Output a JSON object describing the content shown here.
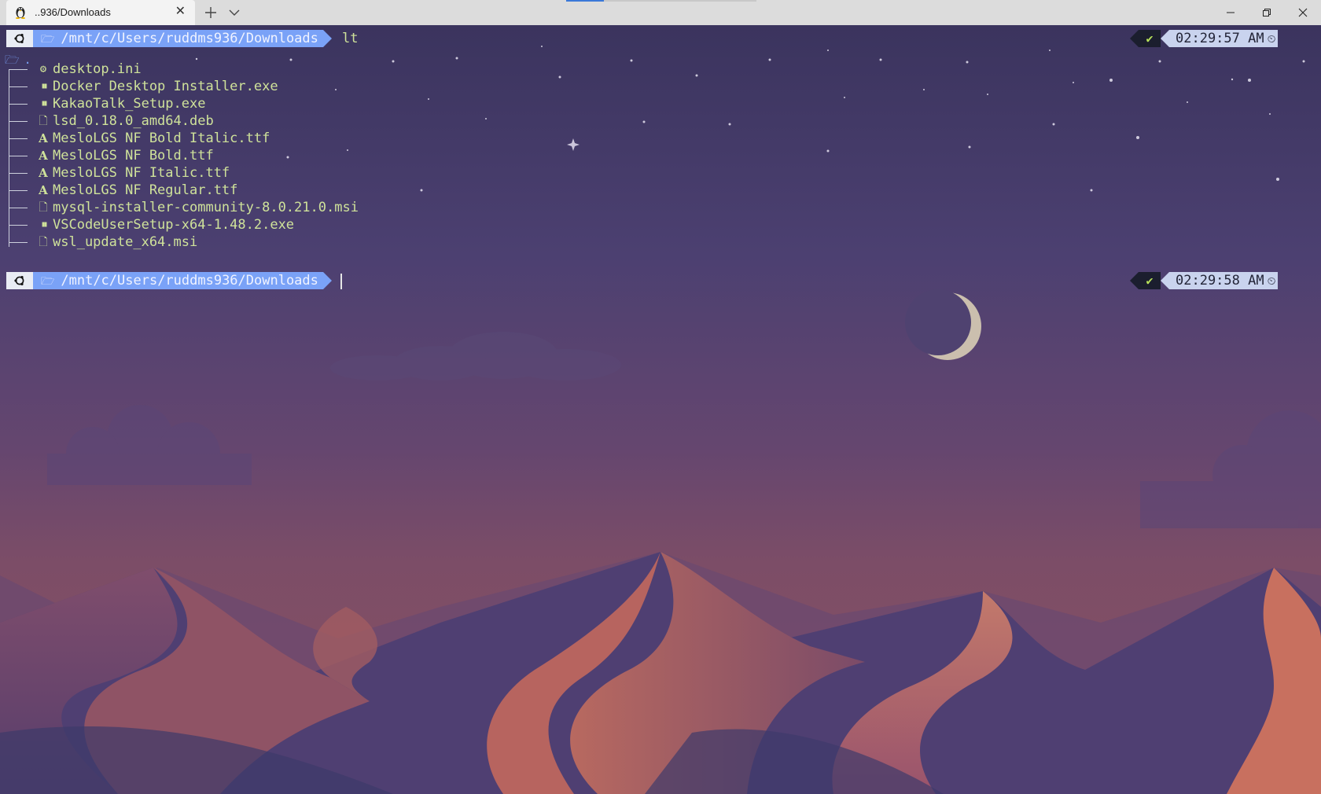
{
  "window": {
    "tab_title": "..936/Downloads",
    "tab_close": "✕",
    "new_tab_icon": "plus-icon",
    "dropdown_icon": "chevron-down-icon",
    "controls": [
      "minimize",
      "restore",
      "close"
    ]
  },
  "prompts": [
    {
      "path": "/mnt/c/Users/ruddms936/Downloads",
      "command": "lt",
      "status": "✔",
      "time": "02:29:57 AM"
    },
    {
      "path": "/mnt/c/Users/ruddms936/Downloads",
      "command": "",
      "status": "✔",
      "time": "02:29:58 AM"
    }
  ],
  "tree": {
    "root": ".",
    "items": [
      {
        "name": "desktop.ini",
        "icon": "gear-icon"
      },
      {
        "name": "Docker Desktop Installer.exe",
        "icon": "windows-icon"
      },
      {
        "name": "KakaoTalk_Setup.exe",
        "icon": "windows-icon"
      },
      {
        "name": "lsd_0.18.0_amd64.deb",
        "icon": "file-icon"
      },
      {
        "name": "MesloLGS NF Bold Italic.ttf",
        "icon": "font-icon"
      },
      {
        "name": "MesloLGS NF Bold.ttf",
        "icon": "font-icon"
      },
      {
        "name": "MesloLGS NF Italic.ttf",
        "icon": "font-icon"
      },
      {
        "name": "MesloLGS NF Regular.ttf",
        "icon": "font-icon"
      },
      {
        "name": "mysql-installer-community-8.0.21.0.msi",
        "icon": "file-icon"
      },
      {
        "name": "VSCodeUserSetup-x64-1.48.2.exe",
        "icon": "windows-icon"
      },
      {
        "name": "wsl_update_x64.msi",
        "icon": "file-icon"
      }
    ]
  },
  "colors": {
    "path_segment": "#7aa2f7",
    "filename": "#cfe29a",
    "status_ok": "#b8e35a",
    "time_segment": "#c9d3ee"
  }
}
